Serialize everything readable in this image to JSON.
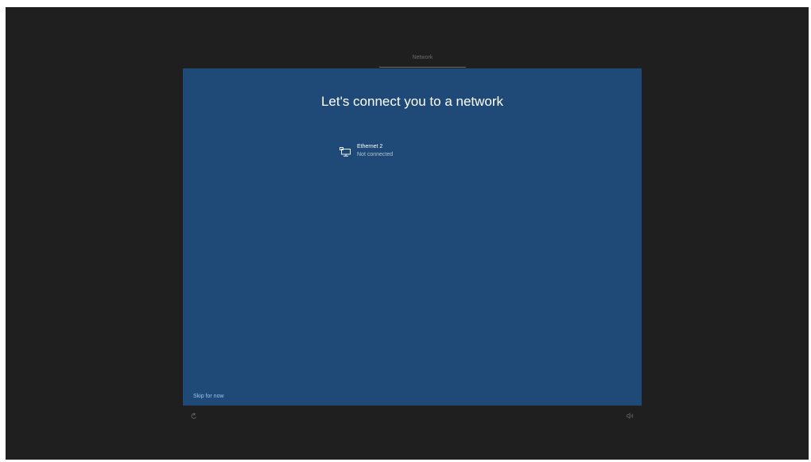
{
  "header": {
    "step_label": "Network"
  },
  "main": {
    "title": "Let's connect you to a network",
    "networks": [
      {
        "name": "Ethernet 2",
        "status": "Not connected",
        "icon": "ethernet-icon"
      }
    ],
    "skip_label": "Skip for now"
  },
  "footer": {
    "left_icon": "ease-of-access-icon",
    "right_icon": "volume-icon"
  },
  "colors": {
    "background": "#1f1f1f",
    "panel": "#1f4a77",
    "link": "#9cc3eb"
  }
}
